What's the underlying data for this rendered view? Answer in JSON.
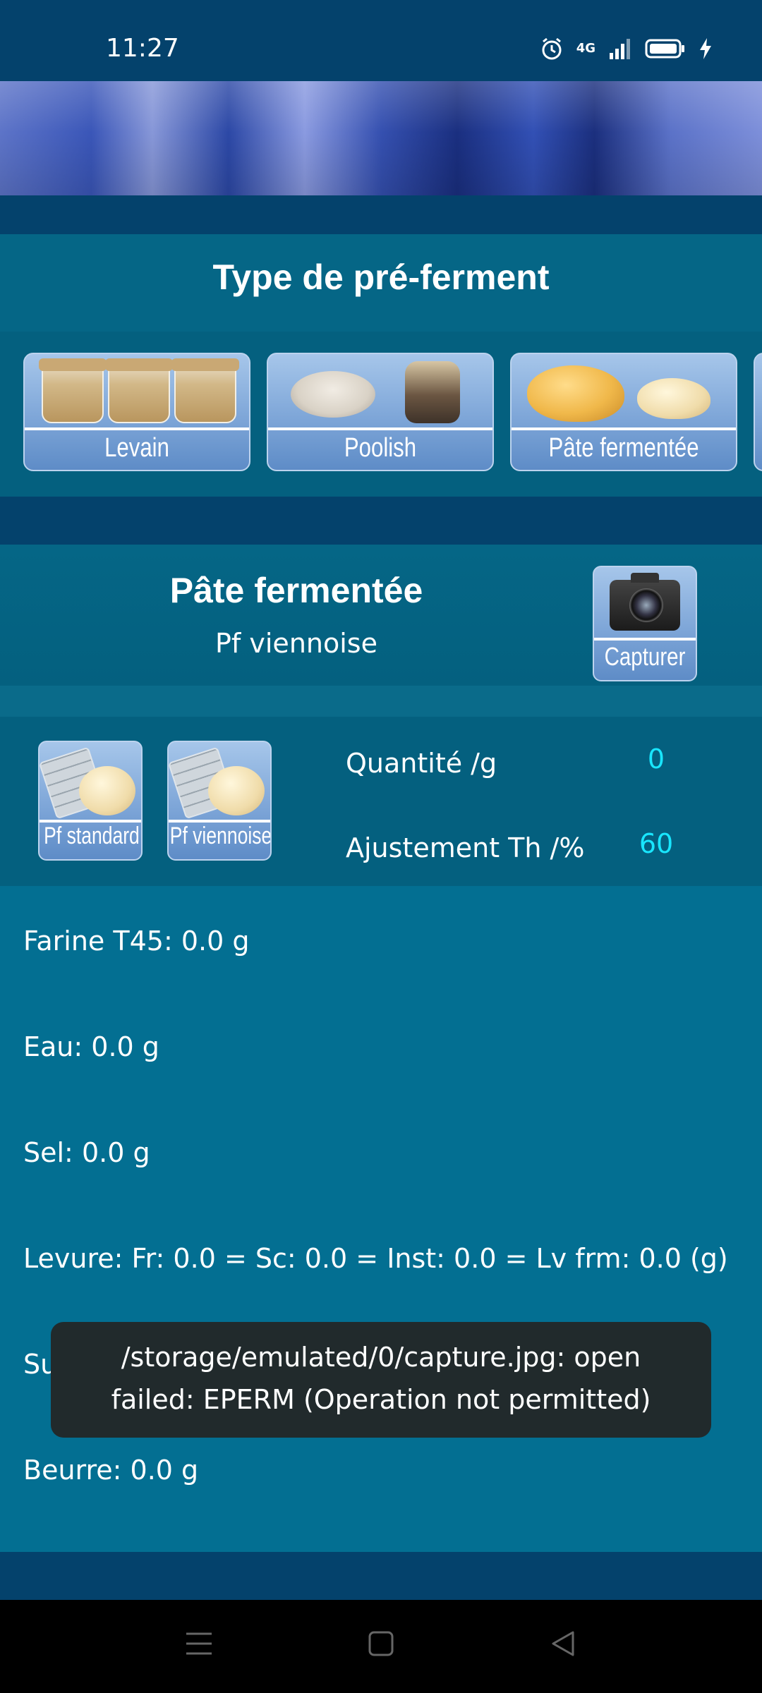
{
  "status_bar": {
    "time": "11:27",
    "network": "4G"
  },
  "section": {
    "title": "Type de pré-ferment"
  },
  "preferments": [
    {
      "label": "Levain"
    },
    {
      "label": "Poolish"
    },
    {
      "label": "Pâte fermentée"
    }
  ],
  "selected": {
    "title": "Pâte fermentée",
    "subtitle": "Pf viennoise",
    "capture_label": "Capturer"
  },
  "presets": [
    {
      "label": "Pf standard"
    },
    {
      "label": "Pf viennoise"
    }
  ],
  "fields": {
    "quantity_label": "Quantité /g",
    "quantity_value": "0",
    "adjust_label": "Ajustement Th /%",
    "adjust_value": "60"
  },
  "results": [
    "Farine T45: 0.0 g",
    "Eau: 0.0 g",
    "Sel: 0.0 g",
    "Levure: Fr: 0.0 = Sc: 0.0 = Inst: 0.0 = Lv frm: 0.0 (g)",
    "Sucre: 0.0 g",
    "Beurre: 0.0 g"
  ],
  "toast": {
    "line1": "/storage/emulated/0/capture.jpg: open",
    "line2": "failed: EPERM (Operation not permitted)"
  },
  "icons": {
    "status": [
      "alarm-icon",
      "signal-icon",
      "battery-icon",
      "charging-icon"
    ],
    "nav": [
      "menu-icon",
      "home-icon",
      "back-icon"
    ]
  },
  "colors": {
    "background": "#04426c",
    "section": "#056686",
    "results_bg": "#036f92",
    "value_accent": "#19e6ff",
    "toast_bg": "#212a2c"
  }
}
